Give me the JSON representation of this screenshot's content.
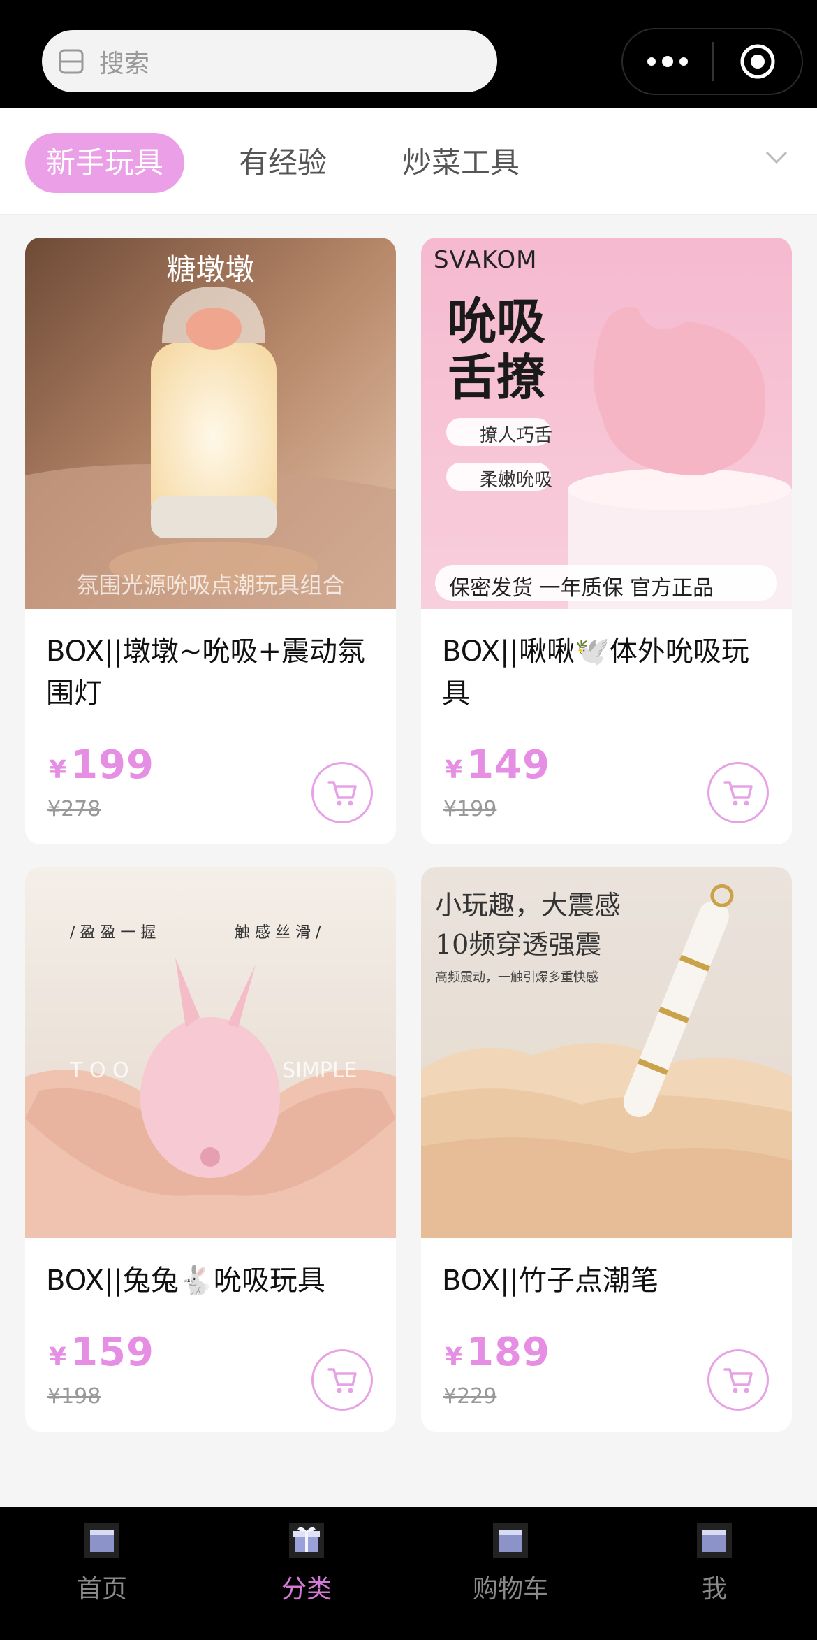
{
  "search": {
    "placeholder": "搜索"
  },
  "capsule": {
    "more_icon": "more-dots-icon",
    "close_icon": "target-icon"
  },
  "tabs": [
    {
      "label": "新手玩具",
      "active": true
    },
    {
      "label": "有经验",
      "active": false
    },
    {
      "label": "炒菜工具",
      "active": false
    }
  ],
  "products": [
    {
      "title": "BOX||墩墩~吮吸+震动氛围灯",
      "price": "199",
      "original": "¥278",
      "image_text": {
        "top": "糖墩墩",
        "bottom": "氛围光源吮吸点潮玩具组合"
      }
    },
    {
      "title": "BOX||啾啾🕊️体外吮吸玩具",
      "price": "149",
      "original": "¥199",
      "image_text": {
        "brand": "SVAKOM",
        "headline": "吮吸舌撩",
        "feature1": "撩人巧舌",
        "feature2": "柔嫩吮吸",
        "badges": "保密发货   一年质保   官方正品"
      }
    },
    {
      "title": "BOX||兔兔🐇吮吸玩具",
      "price": "159",
      "original": "¥198",
      "image_text": {
        "top_left": "/ 盈 盈 一 握",
        "top_right": "触 感 丝 滑 /",
        "left": "T O O",
        "right": "SIMPLE"
      }
    },
    {
      "title": "BOX||竹子点潮笔",
      "price": "189",
      "original": "¥229",
      "image_text": {
        "line1": "小玩趣，大震感",
        "line2": "10频穿透强震",
        "line3": "高频震动，一触引爆多重快感"
      }
    }
  ],
  "currency": "¥",
  "nav": [
    {
      "label": "首页",
      "active": false
    },
    {
      "label": "分类",
      "active": true
    },
    {
      "label": "购物车",
      "active": false
    },
    {
      "label": "我",
      "active": false
    }
  ],
  "colors": {
    "accent": "#ea9fe6",
    "price": "#e58ee3",
    "bar": "#000000",
    "nav_active": "#d37ad6"
  }
}
